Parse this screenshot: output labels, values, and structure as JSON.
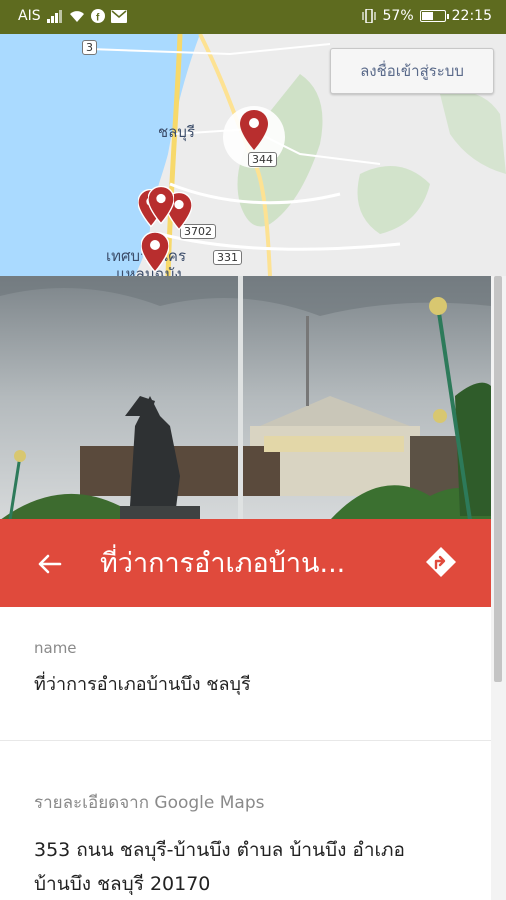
{
  "status_bar": {
    "carrier": "AIS",
    "battery_percent": "57%",
    "battery_level": 0.57,
    "time": "22:15"
  },
  "map": {
    "login_button": "ลงชื่อเข้าสู่ระบบ",
    "labels": {
      "city": "ชลบุรี",
      "town_line1": "เทศบาลนคร",
      "town_line2": "แหลมฉบัง"
    },
    "route_shields": [
      "3",
      "344",
      "3702",
      "331"
    ]
  },
  "place": {
    "title": "ที่ว่าการอำเภอบ้าน...",
    "name_label": "name",
    "name_value": "ที่ว่าการอำเภอบ้านบึง ชลบุรี",
    "details_label": "รายละเอียดจาก Google Maps",
    "address_line1": "353 ถนน ชลบุรี-บ้านบึง ตำบล บ้านบึง อำเภอ",
    "address_line2": "บ้านบึง ชลบุรี 20170"
  },
  "colors": {
    "status_bar": "#5e6b1f",
    "header": "#e04a3c",
    "marker": "#b82e2e"
  }
}
